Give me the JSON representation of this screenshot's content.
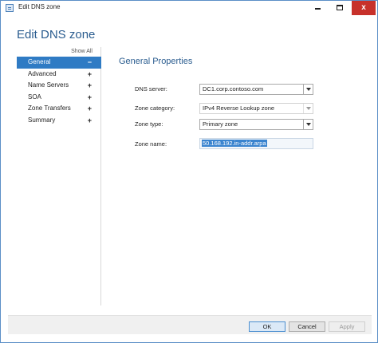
{
  "window": {
    "title": "Edit DNS zone",
    "minimize_icon": "minimize-icon",
    "maximize_icon": "maximize-icon",
    "close_glyph": "x"
  },
  "header": {
    "title": "Edit DNS zone"
  },
  "nav": {
    "show_all": "Show All",
    "items": [
      {
        "label": "General",
        "sign": "−",
        "selected": true
      },
      {
        "label": "Advanced",
        "sign": "+"
      },
      {
        "label": "Name Servers",
        "sign": "+"
      },
      {
        "label": "SOA",
        "sign": "+"
      },
      {
        "label": "Zone Transfers",
        "sign": "+"
      },
      {
        "label": "Summary",
        "sign": "+"
      }
    ]
  },
  "main": {
    "section_title": "General Properties",
    "fields": {
      "dns_server": {
        "label": "DNS server:",
        "value": "DC1.corp.contoso.com"
      },
      "zone_category": {
        "label": "Zone category:",
        "value": "IPv4 Reverse Lookup zone"
      },
      "zone_type": {
        "label": "Zone type:",
        "value": "Primary zone"
      },
      "zone_name": {
        "label": "Zone name:",
        "value": "50.168.192.in-addr.arpa"
      }
    }
  },
  "footer": {
    "ok": "OK",
    "cancel": "Cancel",
    "apply": "Apply"
  },
  "colors": {
    "accent": "#2f7bc4",
    "title_blue": "#2a5c8f",
    "close_red": "#c7312b"
  }
}
